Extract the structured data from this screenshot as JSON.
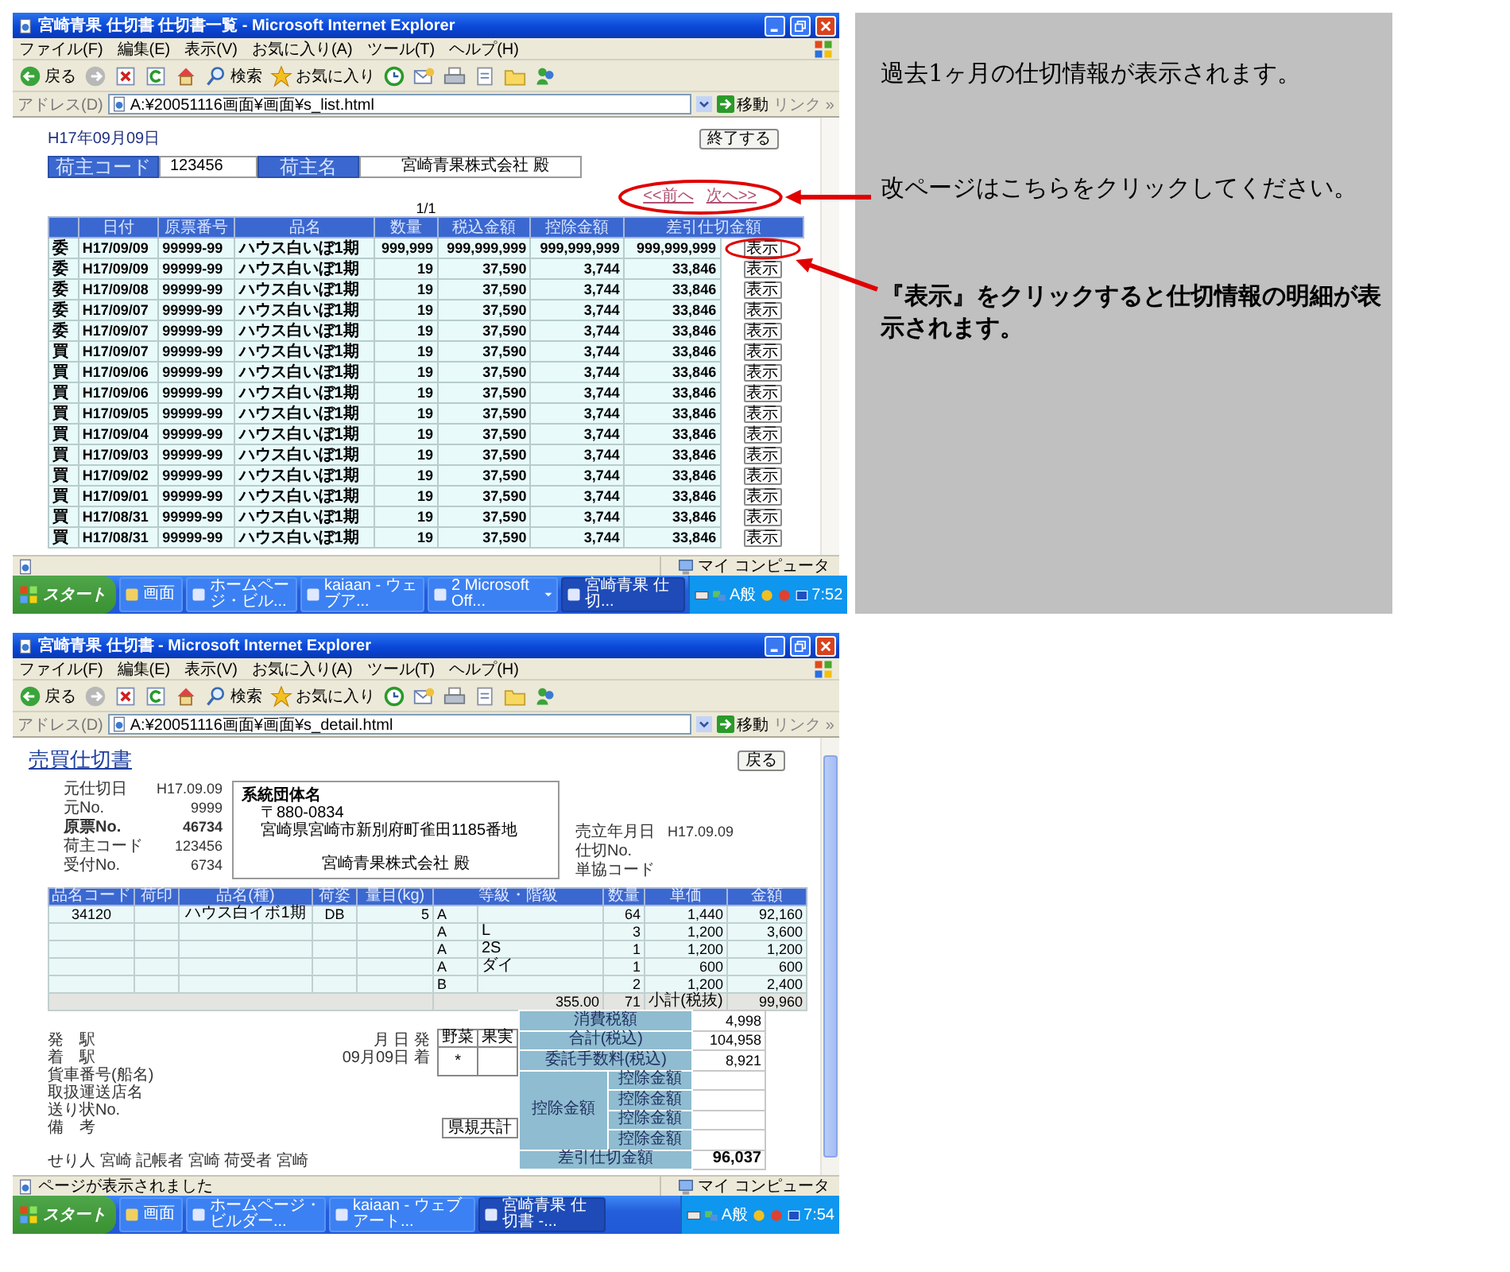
{
  "windows": [
    {
      "kind": "list",
      "title": "宮崎青果 仕切書 仕切書一覧 - Microsoft Internet Explorer",
      "menu": [
        "ファイル(F)",
        "編集(E)",
        "表示(V)",
        "お気に入り(A)",
        "ツール(T)",
        "ヘルプ(H)"
      ],
      "toolbar": [
        {
          "kind": "back",
          "label": "戻る"
        },
        {
          "kind": "forward"
        },
        {
          "kind": "stop"
        },
        {
          "kind": "refresh"
        },
        {
          "kind": "home"
        },
        {
          "kind": "search",
          "label": "検索"
        },
        {
          "kind": "favorites",
          "label": "お気に入り"
        },
        {
          "kind": "history"
        },
        {
          "kind": "mail"
        },
        {
          "kind": "print"
        },
        {
          "kind": "edit"
        },
        {
          "kind": "folder"
        },
        {
          "kind": "messenger"
        }
      ],
      "address_label": "アドレス(D)",
      "address": "A:¥20051116画面¥画面¥s_list.html",
      "go": "移動",
      "links": "リンク »",
      "zone": "マイ コンピュータ",
      "taskbar": {
        "start": "スタート",
        "items": [
          {
            "label": "画面",
            "selected": false,
            "grouped": false
          },
          {
            "label": "ホームページ・ビル...",
            "selected": false,
            "grouped": false
          },
          {
            "label": "kaiaan - ウェブア...",
            "selected": false,
            "grouped": false
          },
          {
            "label": "2 Microsoft Off...",
            "selected": false,
            "grouped": true
          },
          {
            "label": "宮崎青果 仕切...",
            "selected": true,
            "grouped": false
          }
        ],
        "ime": "A般",
        "clock": "7:52"
      },
      "page": {
        "date": "H17年09月09日",
        "close_button": "終了する",
        "shipper_code_label": "荷主コード",
        "shipper_code": "123456",
        "shipper_name_label": "荷主名",
        "shipper_name": "宮崎青果株式会社 殿",
        "page_count": "1/1",
        "prev": "<<前へ",
        "next": "次へ>>",
        "columns": [
          "日付",
          "原票番号",
          "品名",
          "数量",
          "税込金額",
          "控除金額",
          "差引仕切金額"
        ],
        "rows": [
          {
            "type": "委",
            "date": "H17/09/09",
            "slip": "99999-99",
            "item": "ハウス白いぼ1期",
            "qty": "999,999",
            "taxed": "999,999,999",
            "deduction": "999,999,999",
            "net": "999,999,999",
            "button": "表示"
          },
          {
            "type": "委",
            "date": "H17/09/09",
            "slip": "99999-99",
            "item": "ハウス白いぼ1期",
            "qty": "19",
            "taxed": "37,590",
            "deduction": "3,744",
            "net": "33,846",
            "button": "表示"
          },
          {
            "type": "委",
            "date": "H17/09/08",
            "slip": "99999-99",
            "item": "ハウス白いぼ1期",
            "qty": "19",
            "taxed": "37,590",
            "deduction": "3,744",
            "net": "33,846",
            "button": "表示"
          },
          {
            "type": "委",
            "date": "H17/09/07",
            "slip": "99999-99",
            "item": "ハウス白いぼ1期",
            "qty": "19",
            "taxed": "37,590",
            "deduction": "3,744",
            "net": "33,846",
            "button": "表示"
          },
          {
            "type": "委",
            "date": "H17/09/07",
            "slip": "99999-99",
            "item": "ハウス白いぼ1期",
            "qty": "19",
            "taxed": "37,590",
            "deduction": "3,744",
            "net": "33,846",
            "button": "表示"
          },
          {
            "type": "買",
            "date": "H17/09/07",
            "slip": "99999-99",
            "item": "ハウス白いぼ1期",
            "qty": "19",
            "taxed": "37,590",
            "deduction": "3,744",
            "net": "33,846",
            "button": "表示"
          },
          {
            "type": "買",
            "date": "H17/09/06",
            "slip": "99999-99",
            "item": "ハウス白いぼ1期",
            "qty": "19",
            "taxed": "37,590",
            "deduction": "3,744",
            "net": "33,846",
            "button": "表示"
          },
          {
            "type": "買",
            "date": "H17/09/06",
            "slip": "99999-99",
            "item": "ハウス白いぼ1期",
            "qty": "19",
            "taxed": "37,590",
            "deduction": "3,744",
            "net": "33,846",
            "button": "表示"
          },
          {
            "type": "買",
            "date": "H17/09/05",
            "slip": "99999-99",
            "item": "ハウス白いぼ1期",
            "qty": "19",
            "taxed": "37,590",
            "deduction": "3,744",
            "net": "33,846",
            "button": "表示"
          },
          {
            "type": "買",
            "date": "H17/09/04",
            "slip": "99999-99",
            "item": "ハウス白いぼ1期",
            "qty": "19",
            "taxed": "37,590",
            "deduction": "3,744",
            "net": "33,846",
            "button": "表示"
          },
          {
            "type": "買",
            "date": "H17/09/03",
            "slip": "99999-99",
            "item": "ハウス白いぼ1期",
            "qty": "19",
            "taxed": "37,590",
            "deduction": "3,744",
            "net": "33,846",
            "button": "表示"
          },
          {
            "type": "買",
            "date": "H17/09/02",
            "slip": "99999-99",
            "item": "ハウス白いぼ1期",
            "qty": "19",
            "taxed": "37,590",
            "deduction": "3,744",
            "net": "33,846",
            "button": "表示"
          },
          {
            "type": "買",
            "date": "H17/09/01",
            "slip": "99999-99",
            "item": "ハウス白いぼ1期",
            "qty": "19",
            "taxed": "37,590",
            "deduction": "3,744",
            "net": "33,846",
            "button": "表示"
          },
          {
            "type": "買",
            "date": "H17/08/31",
            "slip": "99999-99",
            "item": "ハウス白いぼ1期",
            "qty": "19",
            "taxed": "37,590",
            "deduction": "3,744",
            "net": "33,846",
            "button": "表示"
          },
          {
            "type": "買",
            "date": "H17/08/31",
            "slip": "99999-99",
            "item": "ハウス白いぼ1期",
            "qty": "19",
            "taxed": "37,590",
            "deduction": "3,744",
            "net": "33,846",
            "button": "表示"
          }
        ]
      }
    },
    {
      "kind": "detail",
      "title": "宮崎青果 仕切書 - Microsoft Internet Explorer",
      "menu": [
        "ファイル(F)",
        "編集(E)",
        "表示(V)",
        "お気に入り(A)",
        "ツール(T)",
        "ヘルプ(H)"
      ],
      "toolbar": [
        {
          "kind": "back",
          "label": "戻る"
        },
        {
          "kind": "forward"
        },
        {
          "kind": "stop"
        },
        {
          "kind": "refresh"
        },
        {
          "kind": "home"
        },
        {
          "kind": "search",
          "label": "検索"
        },
        {
          "kind": "favorites",
          "label": "お気に入り"
        },
        {
          "kind": "history"
        },
        {
          "kind": "mail"
        },
        {
          "kind": "print"
        },
        {
          "kind": "edit"
        },
        {
          "kind": "folder"
        },
        {
          "kind": "messenger"
        }
      ],
      "address_label": "アドレス(D)",
      "address": "A:¥20051116画面¥画面¥s_detail.html",
      "go": "移動",
      "links": "リンク »",
      "status": "ページが表示されました",
      "zone": "マイ コンピュータ",
      "taskbar": {
        "start": "スタート",
        "items": [
          {
            "label": "画面",
            "selected": false,
            "grouped": false
          },
          {
            "label": "ホームページ・ビルダー...",
            "selected": false,
            "grouped": false
          },
          {
            "label": "kaiaan - ウェブアート...",
            "selected": false,
            "grouped": false
          },
          {
            "label": "宮崎青果 仕切書 -...",
            "selected": true,
            "grouped": false
          }
        ],
        "ime": "A般",
        "clock": "7:54"
      },
      "page": {
        "title": "売買仕切書",
        "back_button": "戻る",
        "info": [
          {
            "label": "元仕切日",
            "value": "H17.09.09",
            "bold": false
          },
          {
            "label": "元No.",
            "value": "9999",
            "bold": false
          },
          {
            "label": "原票No.",
            "value": "46734",
            "bold": true
          },
          {
            "label": "荷主コード",
            "value": "123456",
            "bold": false
          },
          {
            "label": "受付No.",
            "value": "6734",
            "bold": false
          }
        ],
        "group_label": "系統団体名",
        "postal": "〒880-0834",
        "address": "宮崎県宮崎市新別府町雀田1185番地",
        "recipient": "宮崎青果株式会社 殿",
        "sale_info": [
          {
            "label": "売立年月日",
            "value": "H17.09.09"
          },
          {
            "label": "仕切No."
          },
          {
            "label": "単協コード"
          }
        ],
        "columns": [
          "品名コード",
          "荷印",
          "品名(種)",
          "荷姿",
          "量目(kg)",
          "等級・階級",
          "数量",
          "単価",
          "金額"
        ],
        "lines": [
          {
            "code": "34120",
            "item": "ハウス白イボ1期",
            "pack": "DB",
            "weight": "5",
            "grade": "A",
            "qty": "64",
            "price": "1,440",
            "amount": "92,160"
          },
          {
            "grade": "A",
            "class": "L",
            "qty": "3",
            "price": "1,200",
            "amount": "3,600"
          },
          {
            "grade": "A",
            "class": "2S",
            "qty": "1",
            "price": "1,200",
            "amount": "1,200"
          },
          {
            "grade": "A",
            "class": "ダイ",
            "qty": "1",
            "price": "600",
            "amount": "600"
          },
          {
            "grade": "B",
            "qty": "2",
            "price": "1,200",
            "amount": "2,400"
          }
        ],
        "subtotal": {
          "total": "355.00",
          "qty": "71",
          "label": "小計(税抜)",
          "amount": "99,960"
        },
        "transport": [
          "発　駅",
          "着　駅",
          "貨車番号(船名)",
          "取扱運送店名",
          "送り状No.",
          "備　考"
        ],
        "departure": "月 日 発",
        "arrival": "09月09日 着",
        "produce_columns": [
          "野菜",
          "果実"
        ],
        "produce_mark": "*",
        "pref_total": "県規共計",
        "summary": [
          {
            "label": "消費税額",
            "value": "4,998"
          },
          {
            "label": "合計(税込)",
            "value": "104,958"
          },
          {
            "label": "委託手数料(税込)",
            "value": "8,921"
          }
        ],
        "deduction_label": "控除金額",
        "deduction_items": [
          "控除金額",
          "控除金額",
          "控除金額",
          "控除金額"
        ],
        "net_label": "差引仕切金額",
        "net_value": "96,037",
        "footer": "せり人 宮崎 記帳者 宮崎 荷受者 宮崎"
      }
    }
  ],
  "notes": [
    {
      "text": "過去1ヶ月の仕切情報が表示されます。",
      "bold": false
    },
    {
      "text": "改ページはこちらをクリックしてください。",
      "bold": false
    },
    {
      "text": "『表示』をクリックすると仕切情報の明細が表示されます。",
      "bold": true
    }
  ]
}
